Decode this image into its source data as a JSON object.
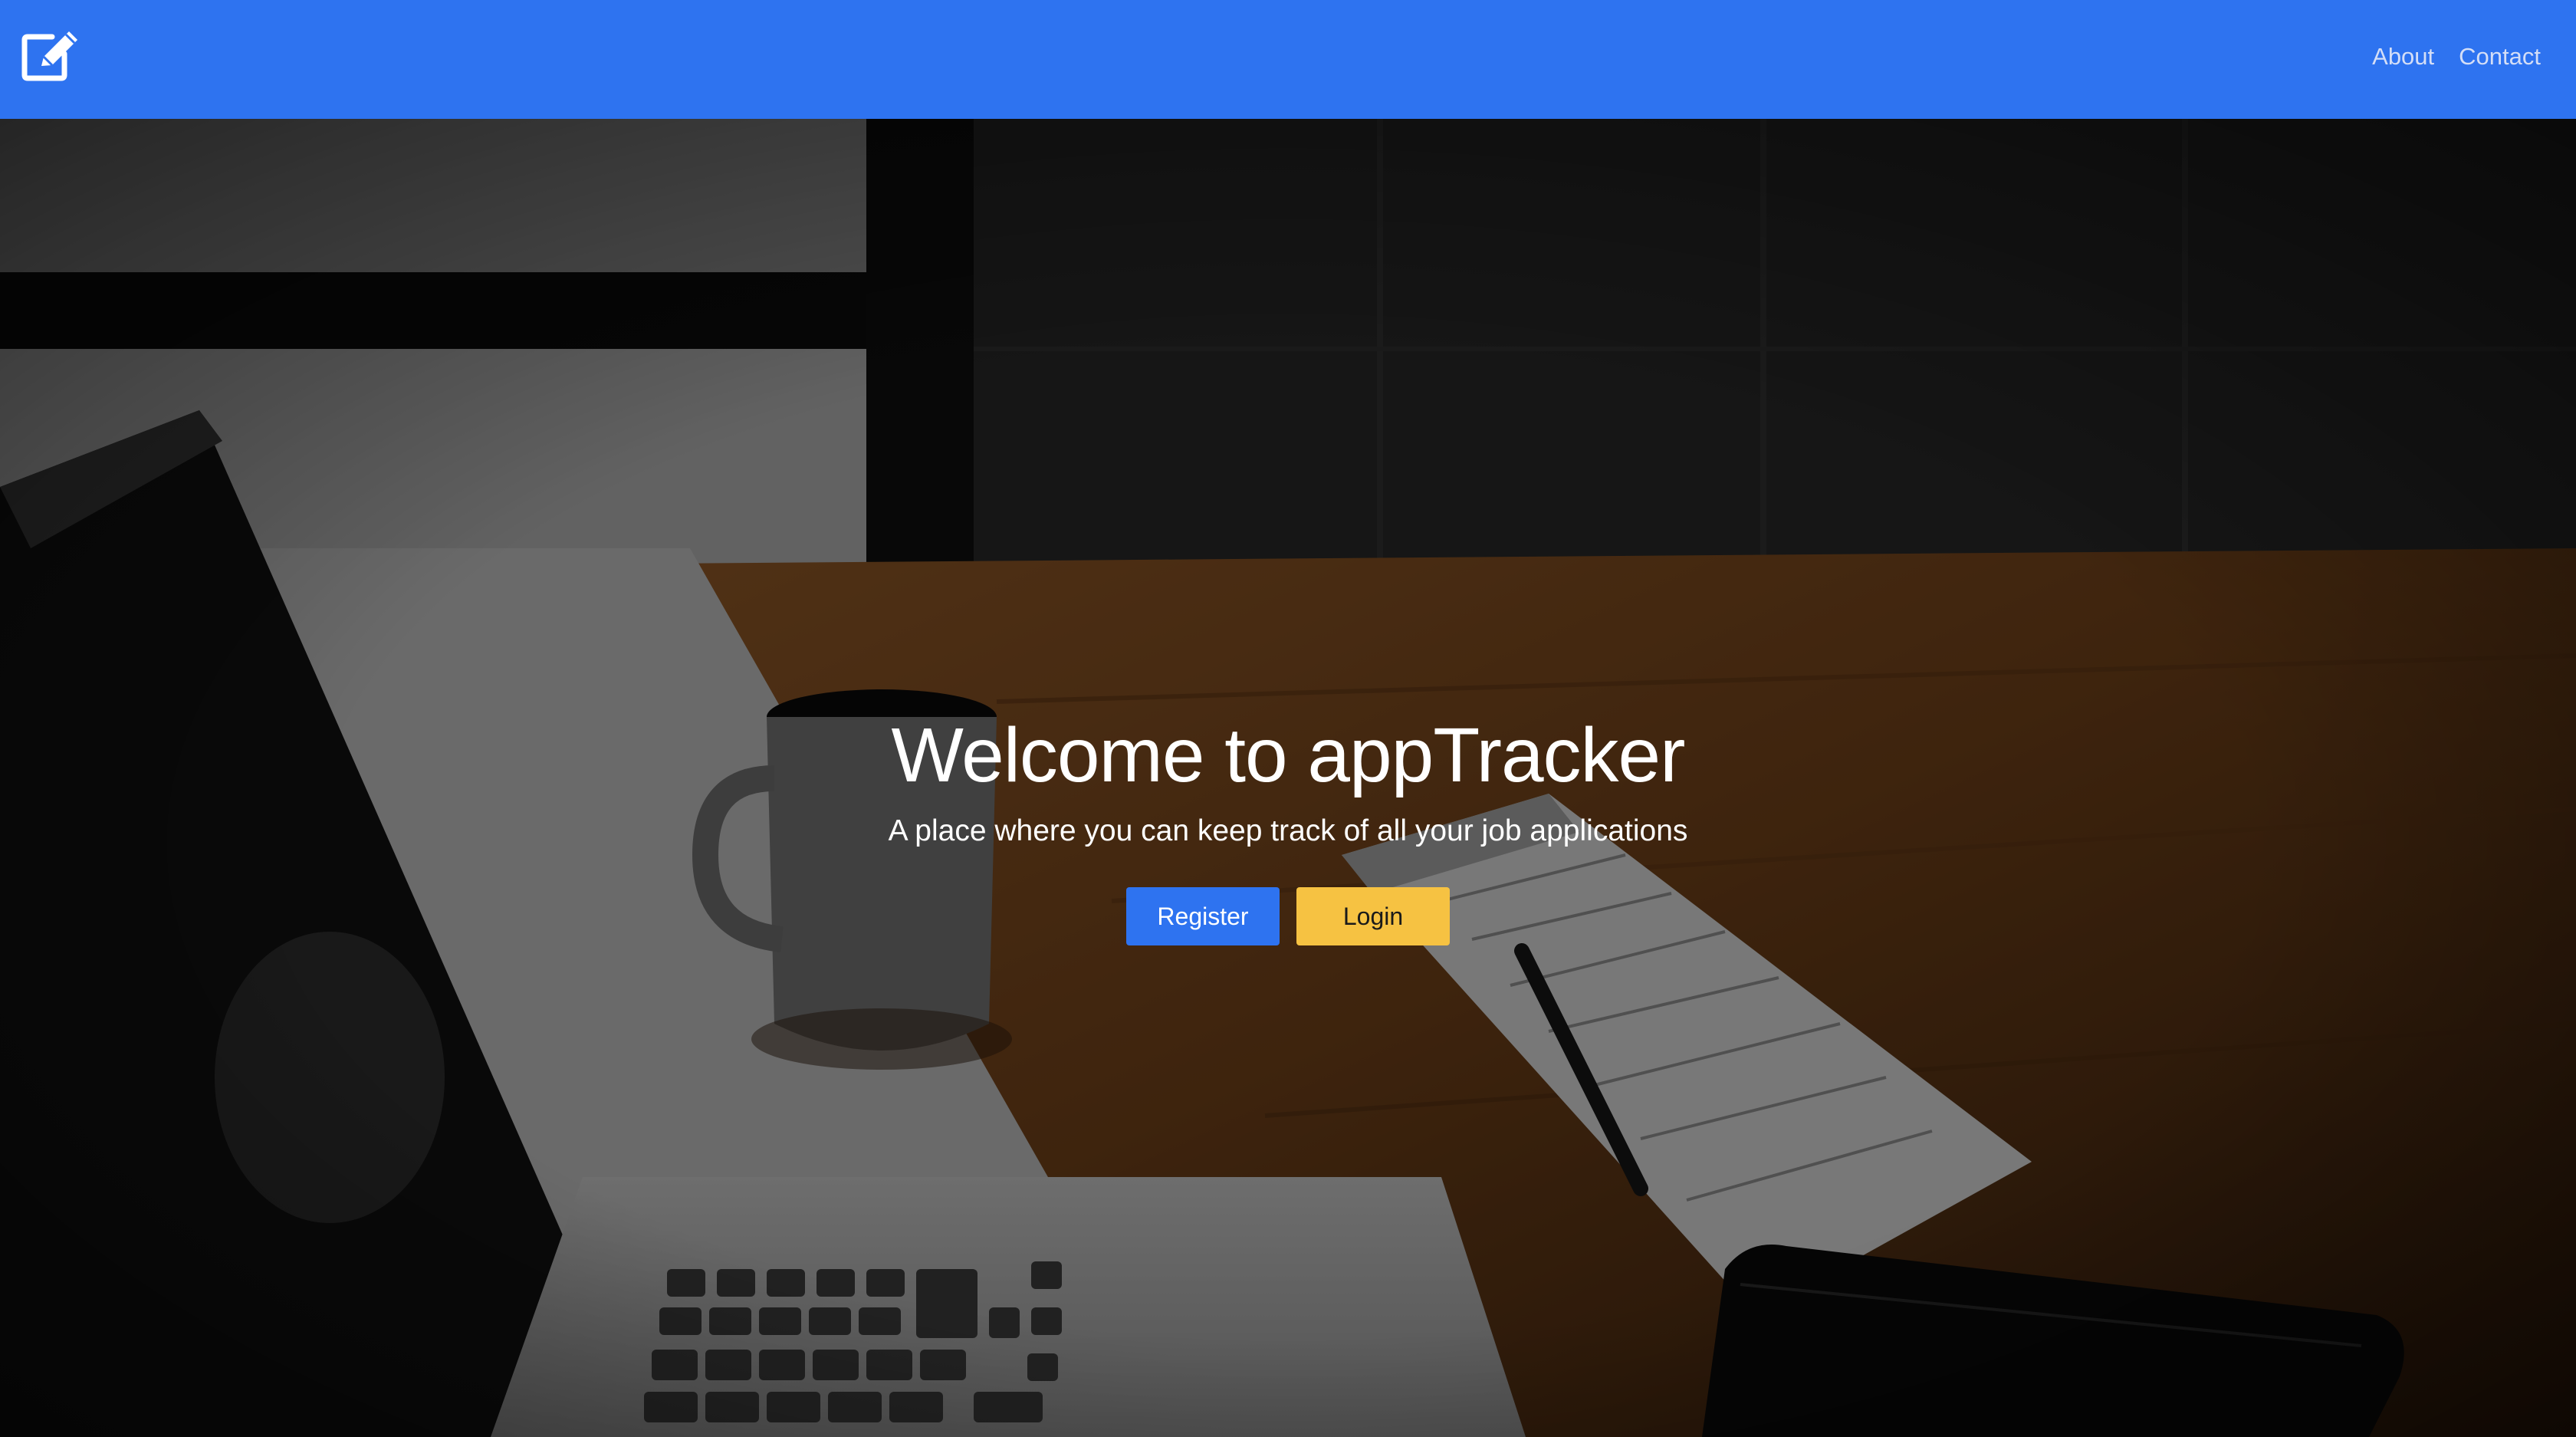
{
  "navbar": {
    "brand_icon": "edit-icon",
    "links": [
      "About",
      "Contact"
    ],
    "background_color": "#2e73f0"
  },
  "hero": {
    "title": "Welcome to appTracker",
    "subtitle": "A place where you can keep track of all your job applications",
    "buttons": {
      "register_label": "Register",
      "login_label": "Login"
    },
    "colors": {
      "register": "#2e73f0",
      "login": "#f6c242"
    }
  }
}
